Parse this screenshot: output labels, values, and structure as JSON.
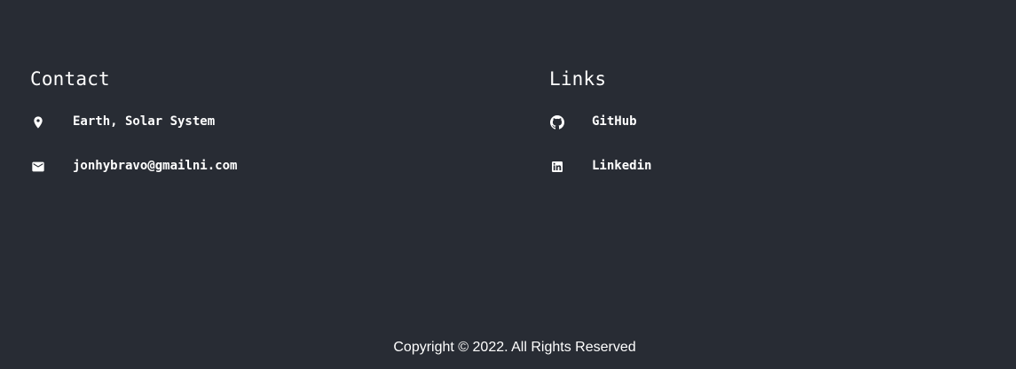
{
  "contact": {
    "title": "Contact",
    "items": [
      {
        "icon": "location-pin-icon",
        "text": "Earth, Solar System"
      },
      {
        "icon": "email-icon",
        "text": "jonhybravo@gmailni.com"
      }
    ]
  },
  "links": {
    "title": "Links",
    "items": [
      {
        "icon": "github-icon",
        "text": "GitHub"
      },
      {
        "icon": "linkedin-icon",
        "text": "Linkedin"
      }
    ]
  },
  "footer": {
    "copyright": "Copyright © 2022. All Rights Reserved"
  },
  "colors": {
    "background": "#282c34",
    "text": "#ffffff"
  }
}
